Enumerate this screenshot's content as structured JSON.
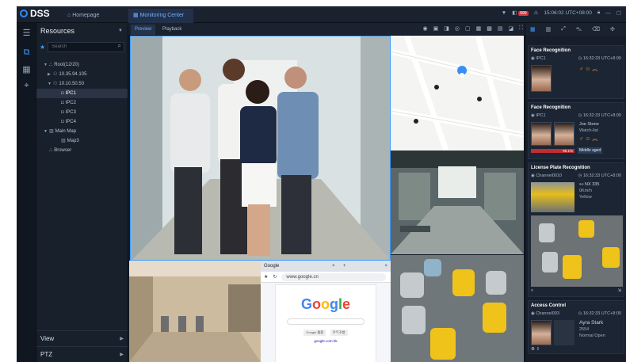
{
  "app": {
    "logo": "DSS",
    "tab_home": "Homepage",
    "tab_active": "Monitoring Center"
  },
  "status": {
    "badge": "999",
    "time": "15:06:02 UTC+08:00"
  },
  "resources": {
    "title": "Resources",
    "search_placeholder": "Search",
    "tree": [
      {
        "label": "Root(12/20)",
        "indent": 1,
        "icon": "org-icon",
        "toggle": "▼"
      },
      {
        "label": "10.35.94.105",
        "indent": 2,
        "icon": "nvr-icon",
        "toggle": "▶"
      },
      {
        "label": "10.10.50.50",
        "indent": 2,
        "icon": "nvr-icon",
        "toggle": "▼"
      },
      {
        "label": "IPC1",
        "indent": 4,
        "icon": "camera-icon",
        "toggle": "",
        "selected": true
      },
      {
        "label": "IPC2",
        "indent": 4,
        "icon": "camera-icon",
        "toggle": ""
      },
      {
        "label": "IPC3",
        "indent": 4,
        "icon": "camera-icon",
        "toggle": ""
      },
      {
        "label": "IPC4",
        "indent": 4,
        "icon": "camera-icon",
        "toggle": ""
      },
      {
        "label": "Main Map",
        "indent": 1,
        "icon": "map-icon",
        "toggle": "▼"
      },
      {
        "label": "Map3",
        "indent": 4,
        "icon": "map-icon",
        "toggle": ""
      },
      {
        "label": "Browser",
        "indent": 1,
        "icon": "browser-icon",
        "toggle": ""
      }
    ],
    "bottom": [
      "View",
      "PTZ"
    ]
  },
  "view_tabs": {
    "preview": "Preview",
    "playback": "Playback"
  },
  "browser": {
    "tab_title": "Google",
    "url": "www.google.cn",
    "logo": "Google",
    "btn1": "Google 搜索",
    "btn2": "手气不错",
    "link": "google.com.hk"
  },
  "events": {
    "face1": {
      "title": "Face Recognition",
      "channel": "IPC1",
      "time": "16:32:33 UTC+8:00"
    },
    "face2": {
      "title": "Face Recognition",
      "channel": "IPC1",
      "time": "16:32:33 UTC+8:00",
      "name": "Joe Stone",
      "list": "Watch-list",
      "similarity": "96.1%",
      "tag": "Middle aged"
    },
    "plate": {
      "title": "License Plate Recognition",
      "channel": "Channel0010",
      "time": "16:32:33 UTC+8:00",
      "plate": "NX 335",
      "speed": "0Km/h",
      "color": "Yellow"
    },
    "access": {
      "title": "Access Control",
      "channel": "Channel003",
      "time": "16:32:33 UTC+8:00",
      "name": "Ayra Stark",
      "id": "2554",
      "status": "Normal Open"
    }
  }
}
